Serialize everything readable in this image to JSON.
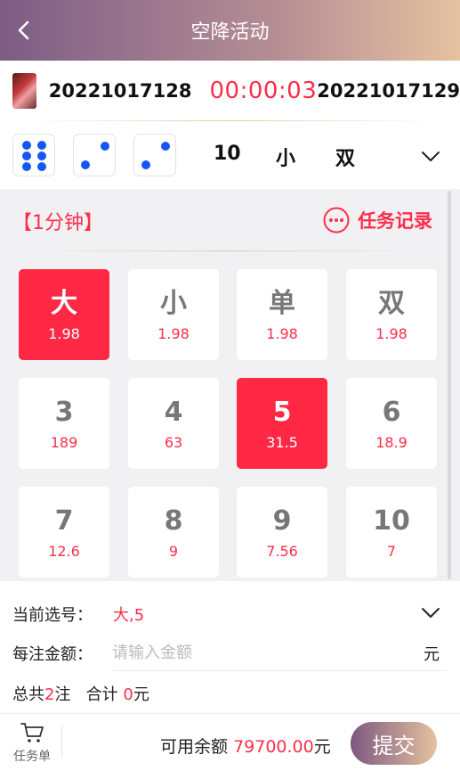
{
  "header": {
    "title": "空降活动"
  },
  "current": {
    "prev_period": "20221017128",
    "timer": "00:00:03",
    "next_period": "20221017129"
  },
  "last_result": {
    "dice": [
      6,
      2,
      2
    ],
    "sum": "10",
    "size": "小",
    "parity": "双"
  },
  "mode": "【1分钟】",
  "records_label": "任务记录",
  "options": [
    {
      "label": "大",
      "odds": "1.98",
      "selected": true
    },
    {
      "label": "小",
      "odds": "1.98",
      "selected": false
    },
    {
      "label": "单",
      "odds": "1.98",
      "selected": false
    },
    {
      "label": "双",
      "odds": "1.98",
      "selected": false
    },
    {
      "label": "3",
      "odds": "189",
      "selected": false
    },
    {
      "label": "4",
      "odds": "63",
      "selected": false
    },
    {
      "label": "5",
      "odds": "31.5",
      "selected": true
    },
    {
      "label": "6",
      "odds": "18.9",
      "selected": false
    },
    {
      "label": "7",
      "odds": "12.6",
      "selected": false
    },
    {
      "label": "8",
      "odds": "9",
      "selected": false
    },
    {
      "label": "9",
      "odds": "7.56",
      "selected": false
    },
    {
      "label": "10",
      "odds": "7",
      "selected": false
    }
  ],
  "selection": {
    "label": "当前选号：",
    "value": "大,5"
  },
  "amount": {
    "label": "每注金额：",
    "placeholder": "请输入金额",
    "unit": "元"
  },
  "totals": {
    "prefix": "总共",
    "count": "2",
    "count_unit": "注",
    "sum_prefix": "合计",
    "sum": "0",
    "sum_unit": "元"
  },
  "footer": {
    "cart_label": "任务单",
    "balance_label": "可用余额",
    "balance_value": "79700.00",
    "balance_unit": "元",
    "submit_label": "提交"
  },
  "colors": {
    "accent": "#ff2d4a",
    "dice_pip": "#1557f5",
    "header_gradient_start": "#7d5c85",
    "header_gradient_end": "#e5c2a0"
  }
}
